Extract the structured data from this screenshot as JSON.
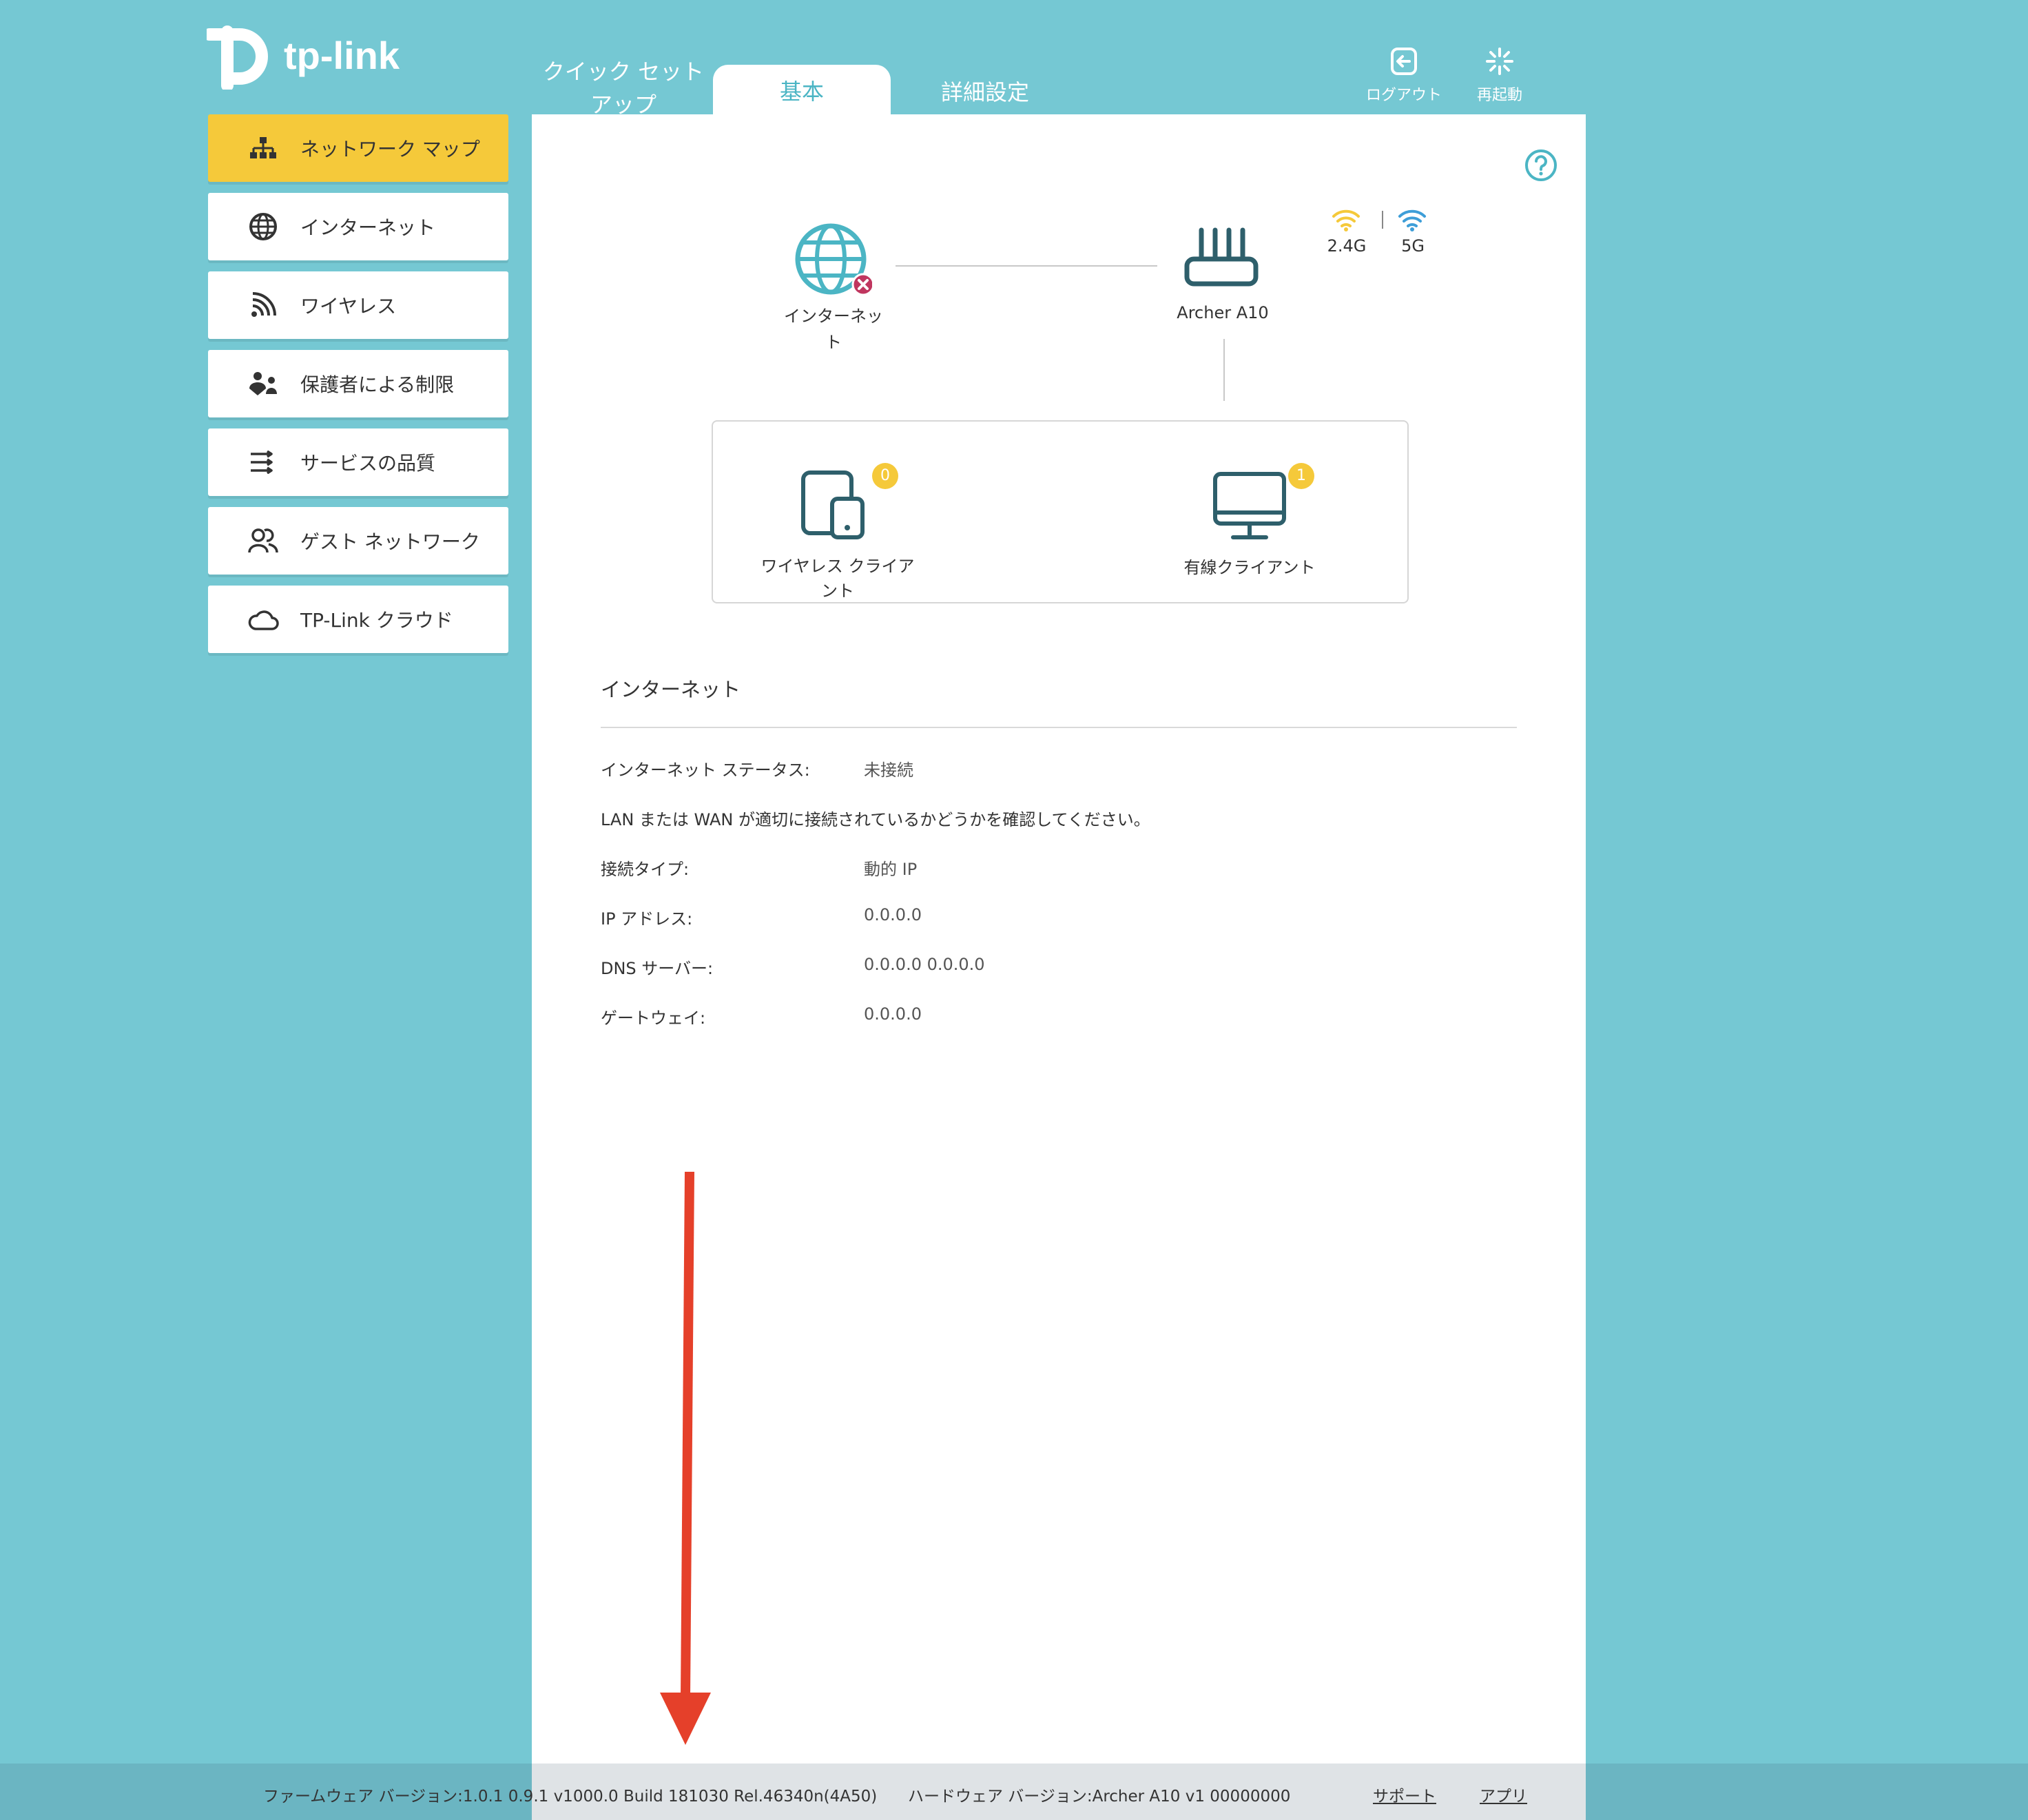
{
  "brand": {
    "name": "tp-link"
  },
  "tabs": [
    {
      "label": "クイック セット アップ"
    },
    {
      "label": "基本"
    },
    {
      "label": "詳細設定"
    }
  ],
  "topbar": {
    "logout": "ログアウト",
    "reboot": "再起動"
  },
  "sidebar": {
    "items": [
      {
        "label": "ネットワーク マップ",
        "icon": "network-map-icon"
      },
      {
        "label": "インターネット",
        "icon": "globe-icon"
      },
      {
        "label": "ワイヤレス",
        "icon": "wireless-icon"
      },
      {
        "label": "保護者による制限",
        "icon": "parental-icon"
      },
      {
        "label": "サービスの品質",
        "icon": "qos-icon"
      },
      {
        "label": "ゲスト ネットワーク",
        "icon": "guest-icon"
      },
      {
        "label": "TP-Link クラウド",
        "icon": "cloud-icon"
      }
    ]
  },
  "map": {
    "internet_label": "インターネット",
    "router_label": "Archer A10",
    "band_24": "2.4G",
    "band_5": "5G",
    "wireless_clients_label": "ワイヤレス クライアント",
    "wireless_clients_count": "0",
    "wired_clients_label": "有線クライアント",
    "wired_clients_count": "1"
  },
  "internet": {
    "title": "インターネット",
    "status_label": "インターネット ステータス:",
    "status_value": "未接続",
    "notice": "LAN または WAN が適切に接続されているかどうかを確認してください。",
    "conn_type_label": "接続タイプ:",
    "conn_type_value": "動的 IP",
    "ip_label": "IP アドレス:",
    "ip_value": "0.0.0.0",
    "dns_label": "DNS サーバー:",
    "dns_value": "0.0.0.0 0.0.0.0",
    "gateway_label": "ゲートウェイ:",
    "gateway_value": "0.0.0.0"
  },
  "footer": {
    "firmware": "ファームウェア バージョン:1.0.1 0.9.1 v1000.0 Build 181030 Rel.46340n(4A50)",
    "hardware": "ハードウェア バージョン:Archer A10 v1 00000000",
    "support": "サポート",
    "app": "アプリ"
  },
  "colors": {
    "background": "#75c8d3",
    "accent": "#4bb5c4",
    "active_nav": "#f5c93a",
    "error": "#c0365f",
    "arrow": "#e5402a"
  }
}
